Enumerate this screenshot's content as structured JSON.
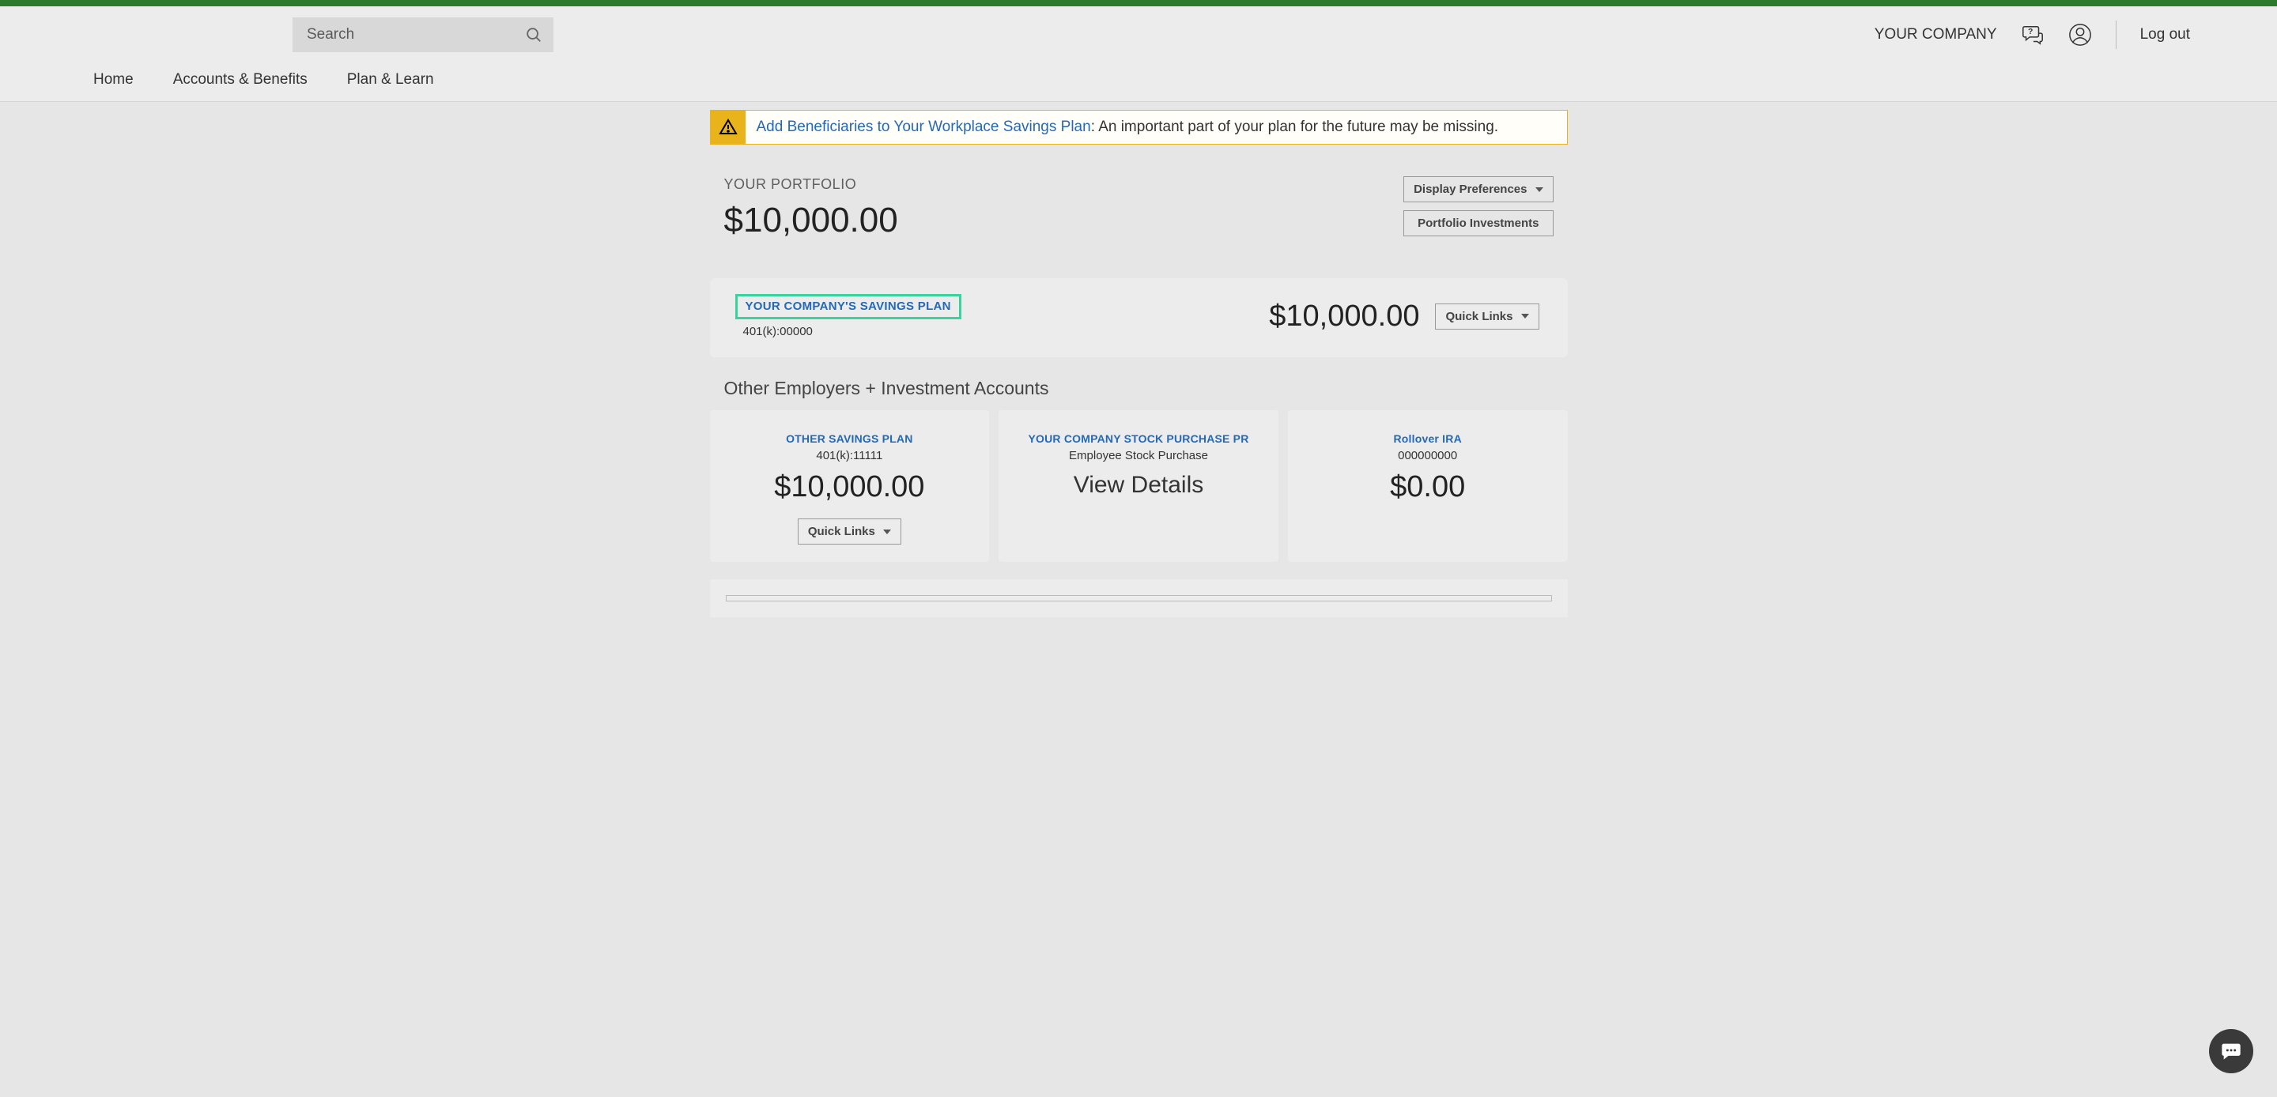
{
  "header": {
    "search_placeholder": "Search",
    "company": "YOUR COMPANY",
    "logout": "Log out"
  },
  "nav": {
    "home": "Home",
    "accounts": "Accounts & Benefits",
    "plan": "Plan & Learn"
  },
  "alert": {
    "link": "Add Beneficiaries to Your Workplace Savings Plan",
    "text": ": An important part of your plan for the future may be missing."
  },
  "portfolio": {
    "title": "YOUR PORTFOLIO",
    "amount": "$10,000.00",
    "display_prefs": "Display Preferences",
    "investments": "Portfolio Investments"
  },
  "main_plan": {
    "name": "YOUR COMPANY'S SAVINGS PLAN",
    "sub": "401(k):00000",
    "amount": "$10,000.00",
    "quick_links": "Quick Links"
  },
  "other_heading": "Other Employers + Investment Accounts",
  "cards": [
    {
      "title": "OTHER SAVINGS PLAN",
      "sub": "401(k):11111",
      "amount": "$10,000.00",
      "quick_links": "Quick Links"
    },
    {
      "title": "YOUR COMPANY STOCK PURCHASE PR",
      "sub": "Employee Stock Purchase",
      "view_details": "View Details"
    },
    {
      "title": "Rollover IRA",
      "sub": "000000000",
      "amount": "$0.00"
    }
  ]
}
